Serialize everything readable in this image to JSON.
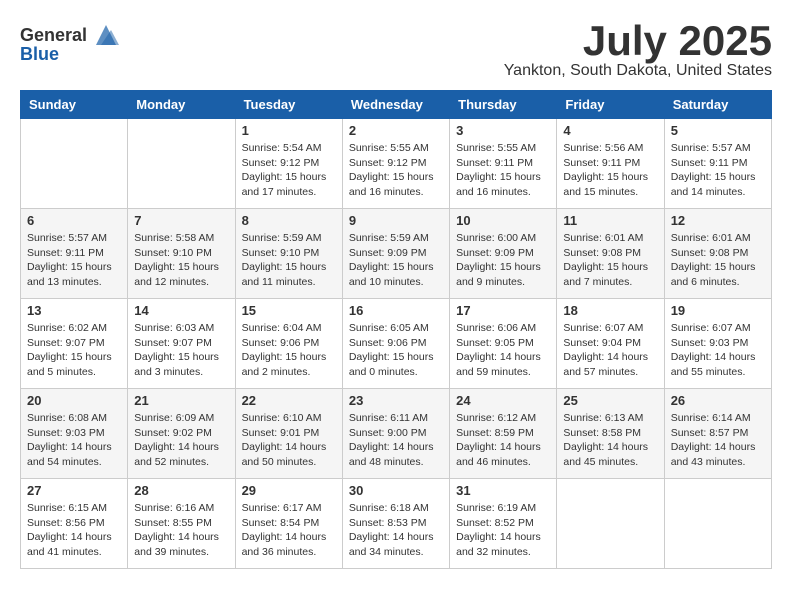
{
  "header": {
    "logo_general": "General",
    "logo_blue": "Blue",
    "month_title": "July 2025",
    "location": "Yankton, South Dakota, United States"
  },
  "days_of_week": [
    "Sunday",
    "Monday",
    "Tuesday",
    "Wednesday",
    "Thursday",
    "Friday",
    "Saturday"
  ],
  "weeks": [
    [
      {
        "day": "",
        "sunrise": "",
        "sunset": "",
        "daylight": ""
      },
      {
        "day": "",
        "sunrise": "",
        "sunset": "",
        "daylight": ""
      },
      {
        "day": "1",
        "sunrise": "Sunrise: 5:54 AM",
        "sunset": "Sunset: 9:12 PM",
        "daylight": "Daylight: 15 hours and 17 minutes."
      },
      {
        "day": "2",
        "sunrise": "Sunrise: 5:55 AM",
        "sunset": "Sunset: 9:12 PM",
        "daylight": "Daylight: 15 hours and 16 minutes."
      },
      {
        "day": "3",
        "sunrise": "Sunrise: 5:55 AM",
        "sunset": "Sunset: 9:11 PM",
        "daylight": "Daylight: 15 hours and 16 minutes."
      },
      {
        "day": "4",
        "sunrise": "Sunrise: 5:56 AM",
        "sunset": "Sunset: 9:11 PM",
        "daylight": "Daylight: 15 hours and 15 minutes."
      },
      {
        "day": "5",
        "sunrise": "Sunrise: 5:57 AM",
        "sunset": "Sunset: 9:11 PM",
        "daylight": "Daylight: 15 hours and 14 minutes."
      }
    ],
    [
      {
        "day": "6",
        "sunrise": "Sunrise: 5:57 AM",
        "sunset": "Sunset: 9:11 PM",
        "daylight": "Daylight: 15 hours and 13 minutes."
      },
      {
        "day": "7",
        "sunrise": "Sunrise: 5:58 AM",
        "sunset": "Sunset: 9:10 PM",
        "daylight": "Daylight: 15 hours and 12 minutes."
      },
      {
        "day": "8",
        "sunrise": "Sunrise: 5:59 AM",
        "sunset": "Sunset: 9:10 PM",
        "daylight": "Daylight: 15 hours and 11 minutes."
      },
      {
        "day": "9",
        "sunrise": "Sunrise: 5:59 AM",
        "sunset": "Sunset: 9:09 PM",
        "daylight": "Daylight: 15 hours and 10 minutes."
      },
      {
        "day": "10",
        "sunrise": "Sunrise: 6:00 AM",
        "sunset": "Sunset: 9:09 PM",
        "daylight": "Daylight: 15 hours and 9 minutes."
      },
      {
        "day": "11",
        "sunrise": "Sunrise: 6:01 AM",
        "sunset": "Sunset: 9:08 PM",
        "daylight": "Daylight: 15 hours and 7 minutes."
      },
      {
        "day": "12",
        "sunrise": "Sunrise: 6:01 AM",
        "sunset": "Sunset: 9:08 PM",
        "daylight": "Daylight: 15 hours and 6 minutes."
      }
    ],
    [
      {
        "day": "13",
        "sunrise": "Sunrise: 6:02 AM",
        "sunset": "Sunset: 9:07 PM",
        "daylight": "Daylight: 15 hours and 5 minutes."
      },
      {
        "day": "14",
        "sunrise": "Sunrise: 6:03 AM",
        "sunset": "Sunset: 9:07 PM",
        "daylight": "Daylight: 15 hours and 3 minutes."
      },
      {
        "day": "15",
        "sunrise": "Sunrise: 6:04 AM",
        "sunset": "Sunset: 9:06 PM",
        "daylight": "Daylight: 15 hours and 2 minutes."
      },
      {
        "day": "16",
        "sunrise": "Sunrise: 6:05 AM",
        "sunset": "Sunset: 9:06 PM",
        "daylight": "Daylight: 15 hours and 0 minutes."
      },
      {
        "day": "17",
        "sunrise": "Sunrise: 6:06 AM",
        "sunset": "Sunset: 9:05 PM",
        "daylight": "Daylight: 14 hours and 59 minutes."
      },
      {
        "day": "18",
        "sunrise": "Sunrise: 6:07 AM",
        "sunset": "Sunset: 9:04 PM",
        "daylight": "Daylight: 14 hours and 57 minutes."
      },
      {
        "day": "19",
        "sunrise": "Sunrise: 6:07 AM",
        "sunset": "Sunset: 9:03 PM",
        "daylight": "Daylight: 14 hours and 55 minutes."
      }
    ],
    [
      {
        "day": "20",
        "sunrise": "Sunrise: 6:08 AM",
        "sunset": "Sunset: 9:03 PM",
        "daylight": "Daylight: 14 hours and 54 minutes."
      },
      {
        "day": "21",
        "sunrise": "Sunrise: 6:09 AM",
        "sunset": "Sunset: 9:02 PM",
        "daylight": "Daylight: 14 hours and 52 minutes."
      },
      {
        "day": "22",
        "sunrise": "Sunrise: 6:10 AM",
        "sunset": "Sunset: 9:01 PM",
        "daylight": "Daylight: 14 hours and 50 minutes."
      },
      {
        "day": "23",
        "sunrise": "Sunrise: 6:11 AM",
        "sunset": "Sunset: 9:00 PM",
        "daylight": "Daylight: 14 hours and 48 minutes."
      },
      {
        "day": "24",
        "sunrise": "Sunrise: 6:12 AM",
        "sunset": "Sunset: 8:59 PM",
        "daylight": "Daylight: 14 hours and 46 minutes."
      },
      {
        "day": "25",
        "sunrise": "Sunrise: 6:13 AM",
        "sunset": "Sunset: 8:58 PM",
        "daylight": "Daylight: 14 hours and 45 minutes."
      },
      {
        "day": "26",
        "sunrise": "Sunrise: 6:14 AM",
        "sunset": "Sunset: 8:57 PM",
        "daylight": "Daylight: 14 hours and 43 minutes."
      }
    ],
    [
      {
        "day": "27",
        "sunrise": "Sunrise: 6:15 AM",
        "sunset": "Sunset: 8:56 PM",
        "daylight": "Daylight: 14 hours and 41 minutes."
      },
      {
        "day": "28",
        "sunrise": "Sunrise: 6:16 AM",
        "sunset": "Sunset: 8:55 PM",
        "daylight": "Daylight: 14 hours and 39 minutes."
      },
      {
        "day": "29",
        "sunrise": "Sunrise: 6:17 AM",
        "sunset": "Sunset: 8:54 PM",
        "daylight": "Daylight: 14 hours and 36 minutes."
      },
      {
        "day": "30",
        "sunrise": "Sunrise: 6:18 AM",
        "sunset": "Sunset: 8:53 PM",
        "daylight": "Daylight: 14 hours and 34 minutes."
      },
      {
        "day": "31",
        "sunrise": "Sunrise: 6:19 AM",
        "sunset": "Sunset: 8:52 PM",
        "daylight": "Daylight: 14 hours and 32 minutes."
      },
      {
        "day": "",
        "sunrise": "",
        "sunset": "",
        "daylight": ""
      },
      {
        "day": "",
        "sunrise": "",
        "sunset": "",
        "daylight": ""
      }
    ]
  ]
}
